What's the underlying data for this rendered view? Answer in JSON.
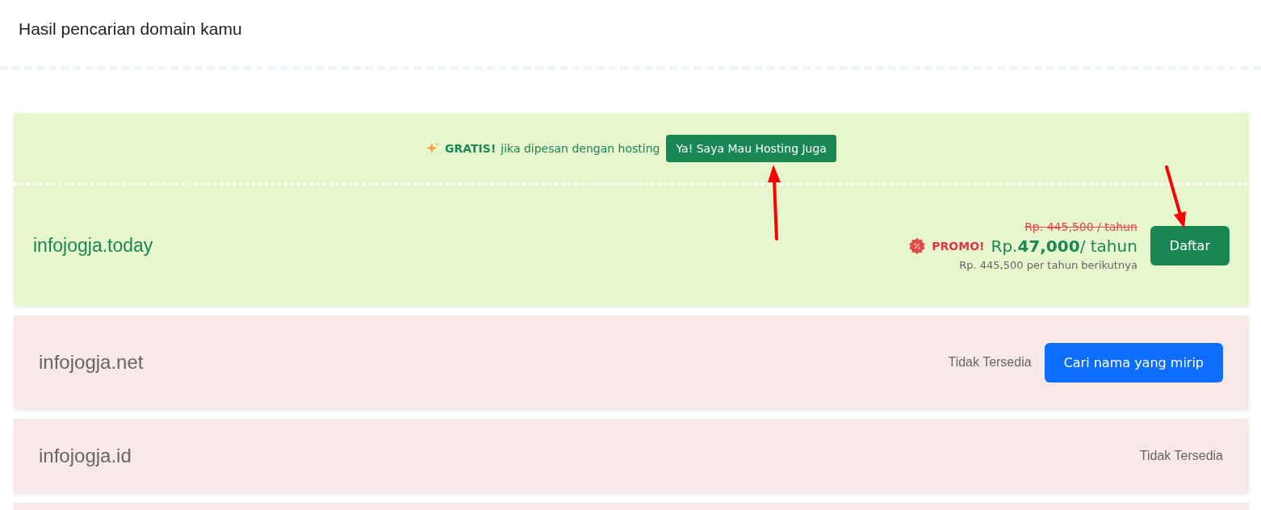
{
  "header": {
    "title": "Hasil pencarian domain kamu"
  },
  "available": {
    "promo": {
      "highlight": "GRATIS!",
      "text": "jika dipesan dengan hosting",
      "button": "Ya! Saya Mau Hosting Juga"
    },
    "domain": "infojogja.today",
    "old_price": "Rp. 445,500 / tahun",
    "promo_label": "PROMO!",
    "price": "Rp.**47,000**/ tahun",
    "renewal": "Rp. 445,500 per tahun berikutnya",
    "button": "Daftar"
  },
  "unavailable": [
    {
      "domain": "infojogja.net",
      "status": "Tidak Tersedia",
      "button": "Cari nama yang mirip"
    },
    {
      "domain": "infojogja.id",
      "status": "Tidak Tersedia"
    }
  ]
}
